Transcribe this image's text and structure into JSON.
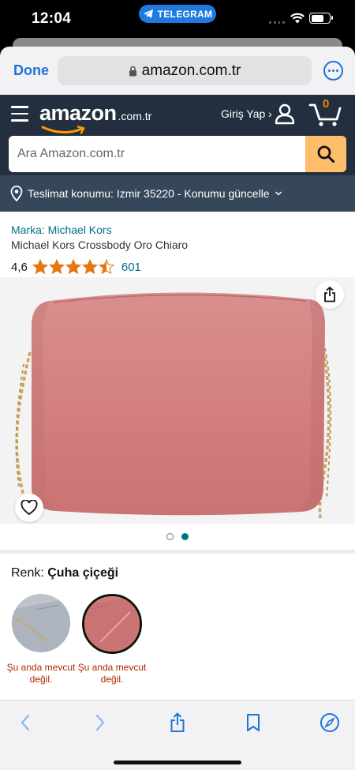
{
  "status_bar": {
    "time": "12:04",
    "app_pill": "TELEGRAM"
  },
  "browser": {
    "done_label": "Done",
    "url": "amazon.com.tr"
  },
  "header": {
    "logo_word": "amazon",
    "logo_tld": ".com.tr",
    "signin_label": "Giriş Yap ›",
    "cart_count": "0",
    "search_placeholder": "Ara Amazon.com.tr",
    "delivery_text": "Teslimat konumu: Izmir 35220 - Konumu güncelle"
  },
  "product": {
    "brand": "Marka: Michael Kors",
    "title": "Michael Kors Crossbody Oro Chiaro",
    "rating_value": "4,6",
    "rating_stars": 4.5,
    "rating_count": "601",
    "image_count": 2,
    "active_image": 2
  },
  "variants": {
    "label_prefix": "Renk:",
    "selected_name": "Çuha çiçeği",
    "options": [
      {
        "caption_line1": "Şu anda mevcut",
        "caption_line2": "değil.",
        "selected": false
      },
      {
        "caption_line1": "Şu anda mevcut",
        "caption_line2": "değil.",
        "selected": true
      }
    ]
  },
  "colors": {
    "amazon_dark": "#232f3e",
    "amazon_nav": "#37475a",
    "search_button": "#febd69",
    "link": "#007185",
    "star": "#e47911",
    "unavailable": "#b12704",
    "ios_blue": "#1f74d6",
    "bag_pink": "#d88a8a"
  },
  "icons": [
    "menu-icon",
    "user-icon",
    "cart-icon",
    "search-icon",
    "location-icon",
    "share-icon",
    "heart-icon",
    "back-icon",
    "forward-icon",
    "bookmarks-icon",
    "compass-icon",
    "lock-icon",
    "more-icon",
    "telegram-icon",
    "wifi-icon",
    "battery-icon"
  ]
}
